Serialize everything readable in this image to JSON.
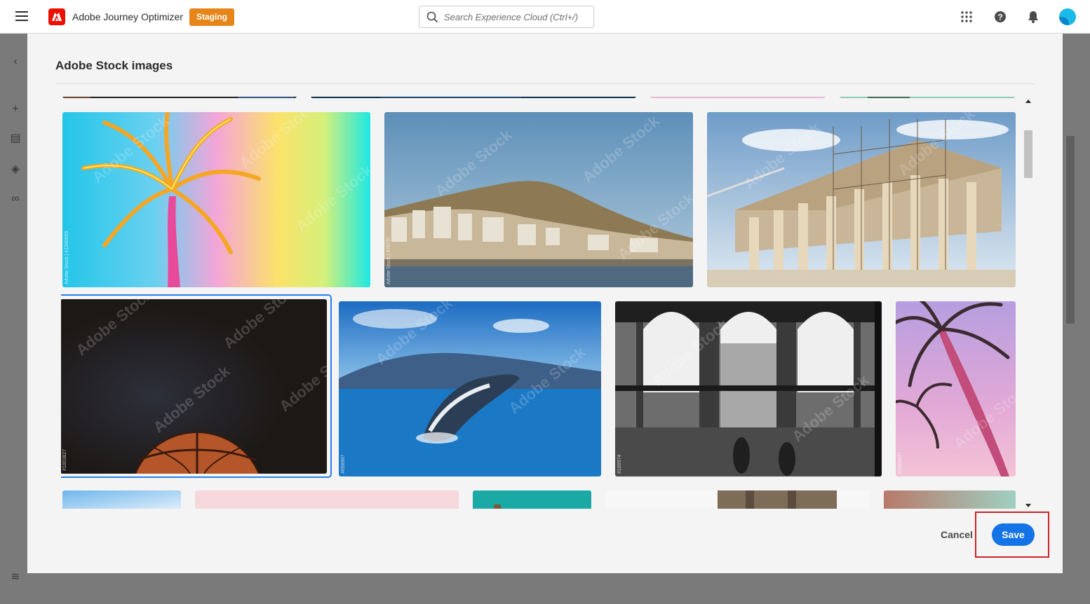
{
  "header": {
    "app_title": "Adobe Journey Optimizer",
    "env_badge": "Staging",
    "search_placeholder": "Search Experience Cloud (Ctrl+/)",
    "icons": [
      "menu-icon",
      "adobe-logo",
      "search-icon",
      "apps-grid-icon",
      "help-icon",
      "notifications-icon",
      "avatar"
    ]
  },
  "dialog": {
    "title": "Adobe Stock images",
    "watermark": "Adobe Stock",
    "images": [
      {
        "subject": "palm-tree-rainbow",
        "id_text": "Adobe Stock | #1390055"
      },
      {
        "subject": "hillside-town",
        "id_text": "Adobe Stock | #76797"
      },
      {
        "subject": "parthenon-scaffolding",
        "id_text": ""
      },
      {
        "subject": "basketball-dark",
        "id_text": "#1003827",
        "selected": true
      },
      {
        "subject": "whale-breach",
        "id_text": "#658987"
      },
      {
        "subject": "gothic-courtyard-bw",
        "id_text": "#100974"
      },
      {
        "subject": "palm-trees-pink-sky",
        "id_text": "#1003827"
      }
    ],
    "cancel_label": "Cancel",
    "save_label": "Save"
  },
  "colors": {
    "accent": "#1473e6",
    "adobe_red": "#eb1000",
    "badge": "#e68619",
    "highlight": "#c9252d"
  }
}
